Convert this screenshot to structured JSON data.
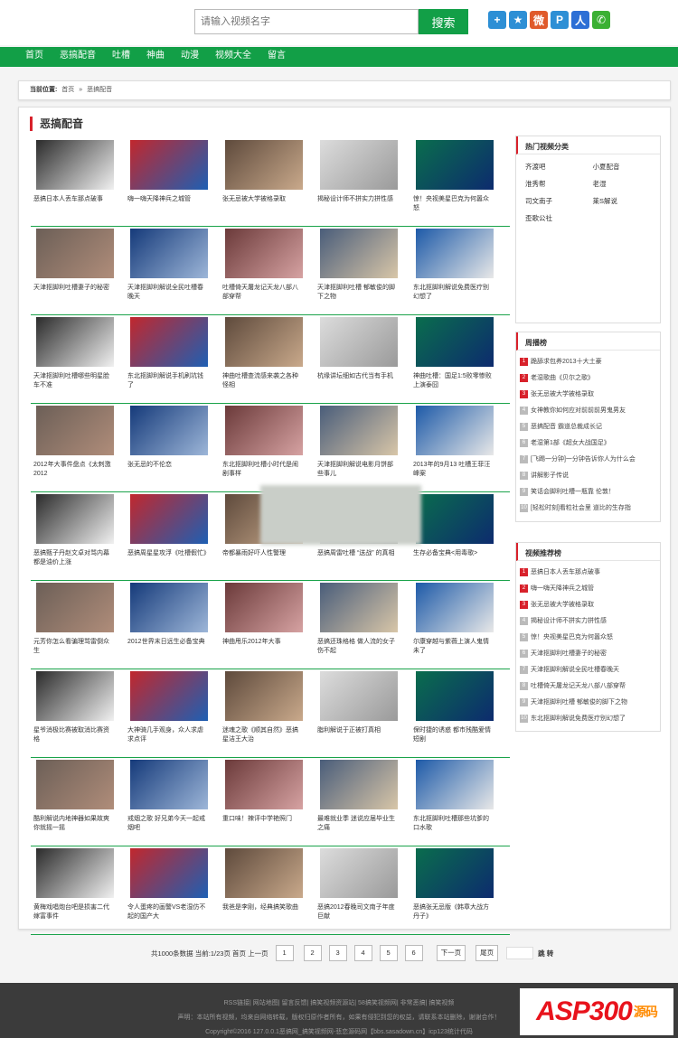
{
  "header": {
    "search_placeholder": "请输入视频名字",
    "search_button": "搜索"
  },
  "share_icons": [
    {
      "name": "plus-share-icon",
      "color": "#2d8fd5",
      "glyph": "+"
    },
    {
      "name": "star-share-icon",
      "color": "#2d8fd5",
      "glyph": "★"
    },
    {
      "name": "weibo-share-icon",
      "color": "#e05a2b",
      "glyph": "微"
    },
    {
      "name": "tencent-share-icon",
      "color": "#2d8fd5",
      "glyph": "P"
    },
    {
      "name": "renren-share-icon",
      "color": "#2d6fd5",
      "glyph": "人"
    },
    {
      "name": "wechat-share-icon",
      "color": "#3bb033",
      "glyph": "✆"
    }
  ],
  "nav": [
    "首页",
    "恶搞配音",
    "吐槽",
    "神曲",
    "动漫",
    "视频大全",
    "留言"
  ],
  "breadcrumb": {
    "label": "当前位置:",
    "home": "首页",
    "sep": "»",
    "current": "恶搞配音"
  },
  "section_title": "恶搞配音",
  "videos": [
    [
      "恶搞日本人丢车那点破事",
      "嗨一嗨天降神兵之城管",
      "张无忌被大学被格录取",
      "揭秘设计师不拼实力拼性感",
      "惊！央视美星巴克为何嚣众怒"
    ],
    [
      "天津抠脚利吐槽妻子的秘密",
      "天津抠脚利解说全民吐槽春晚天",
      "吐槽倚天屠龙记天龙八部八部穿帮",
      "天津抠脚利吐槽 郁敏俊的脚下之物",
      "东北抠脚利解说免费医疗别幻想了"
    ],
    [
      "天津抠脚利吐槽哪些明星脸车不准",
      "东北抠脚利解说手机刷坑钱了",
      "神曲吐槽查流感来袭之各种怪相",
      "杭缘讲坛细如古代当有手机",
      "神曲吐槽：国足1:5败零惨败上演泰囧"
    ],
    [
      "2012年大事件盘点《太刺激2012",
      "张无忌的不伦恋",
      "东北抠脚利吐槽小时代是闹剧事样",
      "天津抠脚利解说电影月饼部些事儿",
      "2013年的9月13 吐槽王菲汪峰案"
    ],
    [
      "恶搞甄子丹赵文卓对骂内幕都是油价上涨",
      "恶搞周星星攻浮《吐槽假忙》",
      "帝都暴雨好吓人性警理",
      "恶搞周雷吐槽 “送战” 的真相",
      "生存必备宝典<用毒歌>"
    ],
    [
      "元芳你怎么看骗理骂雷倒众生",
      "2012世界末日远生必备宝典",
      "神曲甩乐2012年大事",
      "恶搞还珠格格 做人流的女子伤不起",
      "尔康穿越与紫薇上演人鬼情未了"
    ],
    [
      "星爷消极比赛被取消比赛资格",
      "大神骑几手观身，众人求虐求点评",
      "迷魂之歌《顺其自然》恶搞星洁王大治",
      "脂利解说于正被打真相",
      "保时捷的诱惑 都市残酷爱情短剧"
    ],
    [
      "酷利解说内地神器如果故爽你就摇一摇",
      "戒烟之歌 好兄弟今天一起戒烟吧",
      "重口味！辣评中学艳照门",
      "最难就业季 迷说应届毕业生之痛",
      "东北抠脚利吐槽那些坑爹的口水歌"
    ],
    [
      "黄梅戏唱炮台吧是损害二代嫁富事件",
      "令人蛋疼的画警VS老湿仿不起的国产大",
      "我爸是李刚，经典搞笑歌曲",
      "恶搞2012春晚司文南子年度巨献",
      "恶搞张无忌版《韩章大战方丹子》"
    ]
  ],
  "sidebar": {
    "cat_title": "热门视频分类",
    "cats": [
      "齐渡吧",
      "小夏配音",
      "淮秀帮",
      "老湿",
      "司文南子",
      "莱S解说",
      "歪歌公社"
    ],
    "weekly_title": "周播榜",
    "weekly": [
      "跪舔求包养2013十大土豪",
      "老湿歌曲《贝尔之歌》",
      "张无忌被大学被格录取",
      "女神教你如何应对前前前男鬼男友",
      "恶搞配音 霸道总裁成长记",
      "老湿第1部《超女大战国足》",
      "[飞踢一分钟]一分钟告诉你人为什么会",
      "讲解影子传说",
      "笑话会脚利吐槽一瓶靠 伦敦！",
      "[轻松时刻]看粒社会里 道比的生存指"
    ],
    "rec_title": "视频推荐榜",
    "rec": [
      "恶搞日本人丢车那点破事",
      "嗨一嗨天降神兵之城管",
      "张无忌被大学被格录取",
      "揭秘设计师不拼实力拼性感",
      "惊！央视美星巴克为何嚣众怒",
      "天津抠脚利吐槽妻子的秘密",
      "天津抠脚利解说全民吐槽春晚天",
      "吐槽倚天屠龙记天龙八部八部穿帮",
      "天津抠脚利吐槽 郁敏俊的脚下之物",
      "东北抠脚利解说免费医疗别幻想了"
    ]
  },
  "pager": {
    "summary": "共1000条数据 当前:1/23页 首页 上一页",
    "current": "1",
    "pages": [
      "2",
      "3",
      "4",
      "5",
      "6"
    ],
    "next": "下一页",
    "last": "尾页",
    "jump": "跳 转"
  },
  "footer": {
    "links": "RSS链接| 网站地图| 留言反馈| 搞笑视频资源站| 58搞笑视频网| 非常恶搞| 搞笑视频",
    "notice": "声明：本站所有视频，均来自网络转载，版权归原作者所有，如果有侵犯到您的权益，请联系本站删除，谢谢合作！",
    "copyright": "Copyright©2016 127.0.0.1恶搞网_搞笑视频网-悲恋源码网【bbs.sasadown.cn】icp123统计代码"
  },
  "badge": {
    "main": "ASP300",
    "sub": "源码"
  }
}
